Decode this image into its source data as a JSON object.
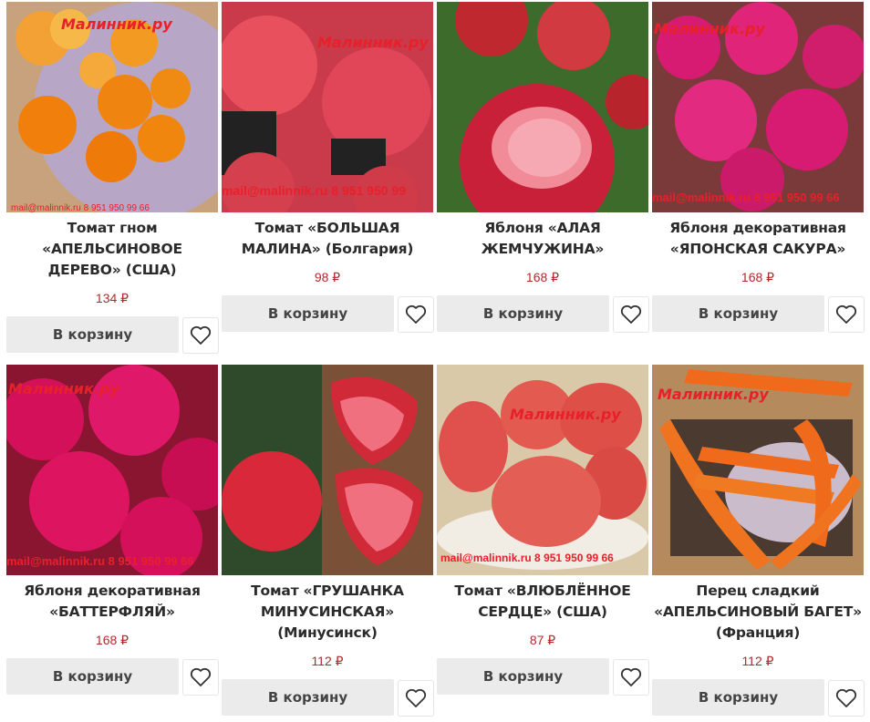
{
  "products": [
    {
      "title": "Томат гном «АПЕЛЬСИНОВОЕ ДЕРЕВО» (США)",
      "price": "134 ₽",
      "cart_label": "В корзину",
      "image_icon": "orange-tomatoes-photo",
      "wm_brand": "Малинник.ру",
      "wm_contact": "mail@malinnik.ru 8 951 950 99 66"
    },
    {
      "title": "Томат «БОЛЬШАЯ МАЛИНА» (Болгария)",
      "price": "98 ₽",
      "cart_label": "В корзину",
      "image_icon": "pink-tomatoes-photo",
      "wm_brand": "Малинник.ру",
      "wm_contact": "mail@malinnik.ru 8 951 950 99"
    },
    {
      "title": "Яблоня «АЛАЯ ЖЕМЧУЖИНА»",
      "price": "168 ₽",
      "cart_label": "В корзину",
      "image_icon": "red-apple-photo",
      "wm_brand": "",
      "wm_contact": ""
    },
    {
      "title": "Яблоня декоративная «ЯПОНСКАЯ САКУРА»",
      "price": "168 ₽",
      "cart_label": "В корзину",
      "image_icon": "pink-blossom-photo",
      "wm_brand": "Малинник.ру",
      "wm_contact": "mail@malinnik.ru 8 951 950 99 66"
    },
    {
      "title": "Яблоня декоративная «БАТТЕРФЛЯЙ»",
      "price": "168 ₽",
      "cart_label": "В корзину",
      "image_icon": "magenta-blossom-photo",
      "wm_brand": "Малинник.ру",
      "wm_contact": "mail@malinnik.ru 8 951 950 99 66"
    },
    {
      "title": "Томат «ГРУШАНКА МИНУСИНСКАЯ» (Минусинск)",
      "price": "112 ₽",
      "cart_label": "В корзину",
      "image_icon": "red-tomatoes-photo",
      "wm_brand": "",
      "wm_contact": ""
    },
    {
      "title": "Томат «ВЛЮБЛЁННОЕ СЕРДЦЕ» (США)",
      "price": "87 ₽",
      "cart_label": "В корзину",
      "image_icon": "heart-tomatoes-photo",
      "wm_brand": "Малинник.ру",
      "wm_contact": "mail@malinnik.ru 8 951 950 99 66"
    },
    {
      "title": "Перец сладкий «АПЕЛЬСИНОВЫЙ БАГЕТ» (Франция)",
      "price": "112 ₽",
      "cart_label": "В корзину",
      "image_icon": "orange-peppers-photo",
      "wm_brand": "Малинник.ру",
      "wm_contact": ""
    }
  ],
  "colors": {
    "price": "#b02a2a",
    "button_bg": "#ebebeb",
    "watermark": "#e8202a"
  }
}
